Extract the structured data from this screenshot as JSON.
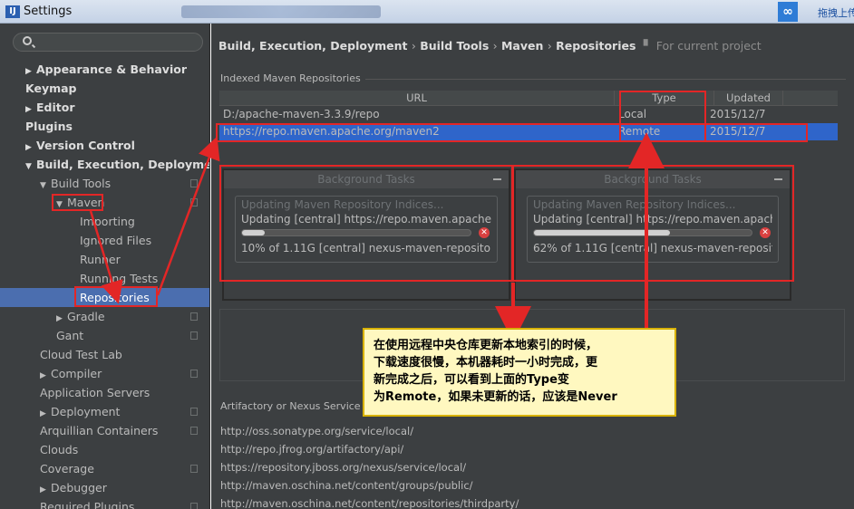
{
  "window": {
    "title": "Settings",
    "app_icon": "IJ",
    "right_badge_icon": "baidu-cloud-icon",
    "right_text": "拖拽上传"
  },
  "sidebar": {
    "search_placeholder": "",
    "items": [
      {
        "label": "Appearance & Behavior",
        "level": 0,
        "arrow": "▶",
        "bold": true,
        "copy": false
      },
      {
        "label": "Keymap",
        "level": 0,
        "arrow": "",
        "bold": true,
        "copy": false
      },
      {
        "label": "Editor",
        "level": 0,
        "arrow": "▶",
        "bold": true,
        "copy": false
      },
      {
        "label": "Plugins",
        "level": 0,
        "arrow": "",
        "bold": true,
        "copy": false
      },
      {
        "label": "Version Control",
        "level": 0,
        "arrow": "▶",
        "bold": true,
        "copy": false
      },
      {
        "label": "Build, Execution, Deployment",
        "level": 0,
        "arrow": "▼",
        "bold": true,
        "copy": false
      },
      {
        "label": "Build Tools",
        "level": 1,
        "arrow": "▼",
        "bold": false,
        "copy": true
      },
      {
        "label": "Maven",
        "level": 2,
        "arrow": "▼",
        "bold": false,
        "copy": true
      },
      {
        "label": "Importing",
        "level": 3,
        "arrow": "",
        "bold": false,
        "copy": false
      },
      {
        "label": "Ignored Files",
        "level": 3,
        "arrow": "",
        "bold": false,
        "copy": false
      },
      {
        "label": "Runner",
        "level": 3,
        "arrow": "",
        "bold": false,
        "copy": false
      },
      {
        "label": "Running Tests",
        "level": 3,
        "arrow": "",
        "bold": false,
        "copy": false
      },
      {
        "label": "Repositories",
        "level": 3,
        "arrow": "",
        "bold": false,
        "copy": false,
        "selected": true
      },
      {
        "label": "Gradle",
        "level": 2,
        "arrow": "▶",
        "bold": false,
        "copy": true
      },
      {
        "label": "Gant",
        "level": 2,
        "arrow": "",
        "bold": false,
        "copy": true
      },
      {
        "label": "Cloud Test Lab",
        "level": 1,
        "arrow": "",
        "bold": false,
        "copy": false
      },
      {
        "label": "Compiler",
        "level": 1,
        "arrow": "▶",
        "bold": false,
        "copy": true
      },
      {
        "label": "Application Servers",
        "level": 1,
        "arrow": "",
        "bold": false,
        "copy": false
      },
      {
        "label": "Deployment",
        "level": 1,
        "arrow": "▶",
        "bold": false,
        "copy": true
      },
      {
        "label": "Arquillian Containers",
        "level": 1,
        "arrow": "",
        "bold": false,
        "copy": true
      },
      {
        "label": "Clouds",
        "level": 1,
        "arrow": "",
        "bold": false,
        "copy": false
      },
      {
        "label": "Coverage",
        "level": 1,
        "arrow": "",
        "bold": false,
        "copy": true
      },
      {
        "label": "Debugger",
        "level": 1,
        "arrow": "▶",
        "bold": false,
        "copy": false
      },
      {
        "label": "Required Plugins",
        "level": 1,
        "arrow": "",
        "bold": false,
        "copy": true
      }
    ]
  },
  "main": {
    "breadcrumb": [
      "Build, Execution, Deployment",
      "Build Tools",
      "Maven",
      "Repositories"
    ],
    "breadcrumb_sep": "›",
    "scope_note": "For current project",
    "indexed_label": "Indexed Maven Repositories",
    "table": {
      "columns": [
        "URL",
        "Type",
        "Updated"
      ],
      "rows": [
        {
          "url": "D:/apache-maven-3.3.9/repo",
          "type": "Local",
          "updated": "2015/12/7",
          "selected": false
        },
        {
          "url": "https://repo.maven.apache.org/maven2",
          "type": "Remote",
          "updated": "2015/12/7",
          "selected": true
        }
      ]
    },
    "background_tasks": [
      {
        "title": "Background Tasks",
        "line1": "Updating Maven Repository Indices...",
        "line2": "Updating [central] https://repo.maven.apache...",
        "progress": 0.1,
        "line3": "10% of 1.11G [central] nexus-maven-reposito..."
      },
      {
        "title": "Background Tasks",
        "line1": "Updating Maven Repository Indices...",
        "line2": "Updating [central] https://repo.maven.apache...",
        "progress": 0.62,
        "line3": "62% of 1.11G [central] nexus-maven-reposito..."
      }
    ],
    "artifactory_label": "Artifactory or Nexus Service U",
    "service_urls": [
      "http://oss.sonatype.org/service/local/",
      "http://repo.jfrog.org/artifactory/api/",
      "https://repository.jboss.org/nexus/service/local/",
      "http://maven.oschina.net/content/groups/public/",
      "http://maven.oschina.net/content/repositories/thirdparty/"
    ]
  },
  "annotation": {
    "lines": [
      "在使用远程中央仓库更新本地索引的时候，",
      "下载速度很慢，本机器耗时一小时完成，更",
      "新完成之后，可以看到上面的Type变",
      "为Remote，如果未更新的话，应该是Never"
    ],
    "color": "#e32626"
  }
}
